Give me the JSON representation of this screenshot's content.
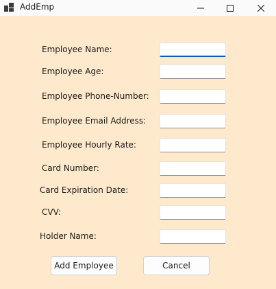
{
  "window": {
    "title": "AddEmp",
    "controls": {
      "minimize": "minimize-icon",
      "maximize": "maximize-icon",
      "close": "close-icon"
    }
  },
  "form": {
    "fields": [
      {
        "label": "Employee Name:",
        "value": ""
      },
      {
        "label": "Employee Age:",
        "value": ""
      },
      {
        "label": "Employee Phone-Number:",
        "value": ""
      },
      {
        "label": "Employee Email Address:",
        "value": ""
      },
      {
        "label": "Employee Hourly Rate:",
        "value": ""
      },
      {
        "label": "Card Number:",
        "value": ""
      },
      {
        "label": "Card Expiration Date:",
        "value": ""
      },
      {
        "label": "CVV:",
        "value": ""
      },
      {
        "label": "Holder Name:",
        "value": ""
      }
    ],
    "focused_field": "Employee Name:"
  },
  "actions": {
    "add_label": "Add Employee",
    "cancel_label": "Cancel"
  },
  "colors": {
    "background": "#ffe9cc",
    "focus_accent": "#0f5bb5"
  }
}
